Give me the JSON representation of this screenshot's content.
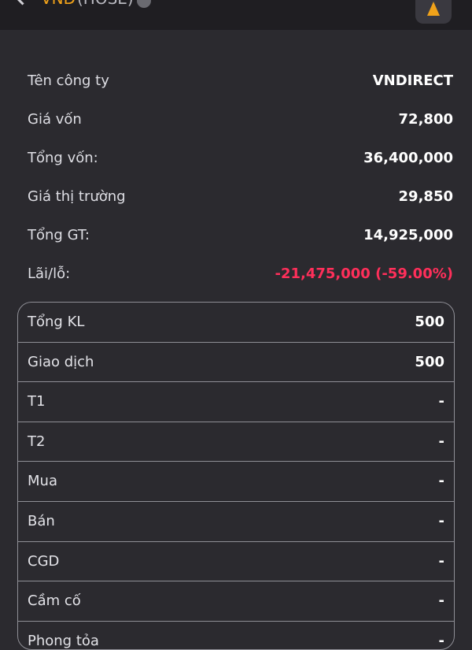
{
  "header": {
    "ticker": "VND",
    "exchange": "(HOSE)"
  },
  "colors": {
    "background": "#2b2a2f",
    "loss": "#ff2f5a",
    "accent": "#f0a21a"
  },
  "icons": {
    "back": "chevron-left-icon",
    "info": "info-icon",
    "alert": "bell-icon"
  },
  "summary": [
    {
      "label": "Tên công ty",
      "value": "VNDIRECT"
    },
    {
      "label": "Giá vốn",
      "value": "72,800"
    },
    {
      "label": "Tổng vốn:",
      "value": "36,400,000"
    },
    {
      "label": "Giá thị trường",
      "value": "29,850"
    },
    {
      "label": "Tổng GT:",
      "value": "14,925,000"
    },
    {
      "label": "Lãi/lỗ:",
      "value": "-21,475,000 (-59.00%)"
    }
  ],
  "table": [
    {
      "label": "Tổng KL",
      "value": "500"
    },
    {
      "label": "Giao dịch",
      "value": "500"
    },
    {
      "label": "T1",
      "value": "-"
    },
    {
      "label": "T2",
      "value": "-"
    },
    {
      "label": "Mua",
      "value": "-"
    },
    {
      "label": "Bán",
      "value": "-"
    },
    {
      "label": "CGD",
      "value": "-"
    },
    {
      "label": "Cầm cố",
      "value": "-"
    },
    {
      "label": "Phong tỏa",
      "value": "-"
    }
  ]
}
